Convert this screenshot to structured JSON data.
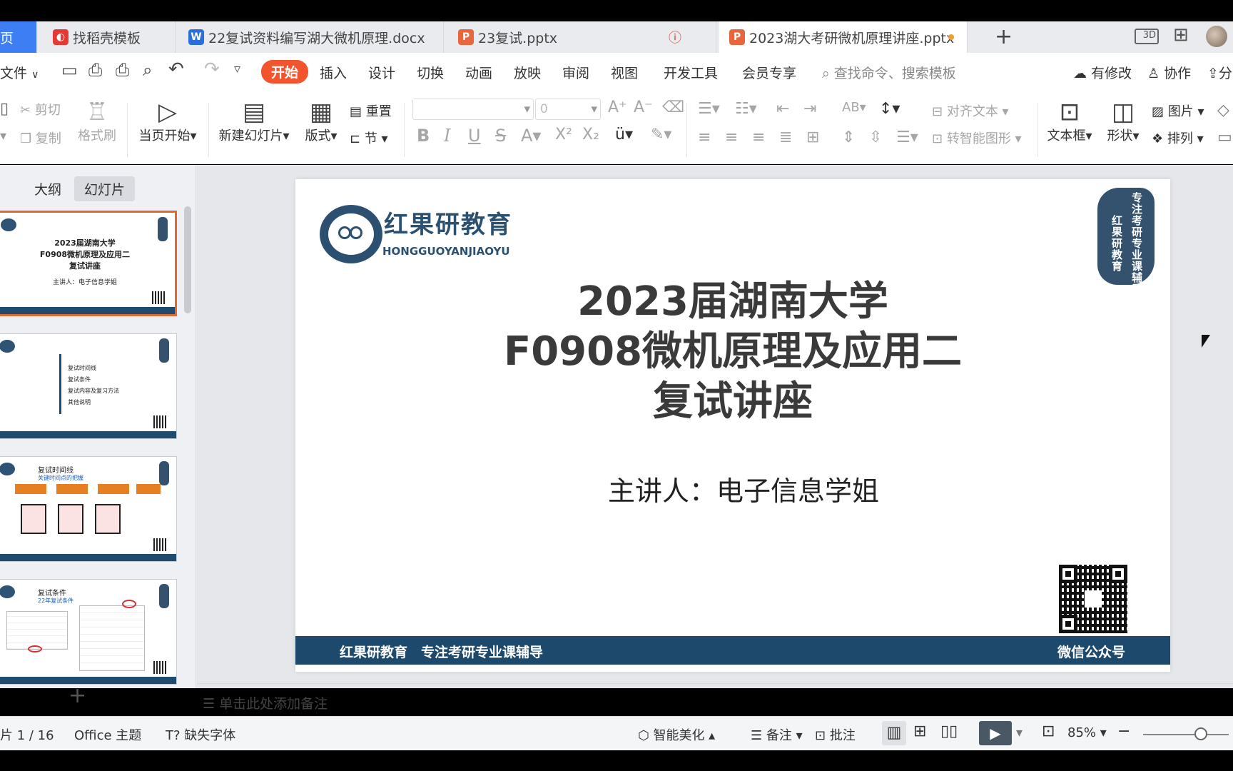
{
  "tabs": [
    {
      "label": "页",
      "color": "#3d7ef5"
    },
    {
      "label": "找稻壳模板",
      "color": "#e53935"
    },
    {
      "label": "22复试资料编写湖大微机原理.docx",
      "color": "#2b6fd8"
    },
    {
      "label": "23复试.pptx",
      "color": "#e7663e"
    },
    {
      "label": "2023湖大考研微机原理讲座.pptx",
      "color": "#e7663e"
    }
  ],
  "tab_new": "+",
  "window_icons": {
    "view": "3D",
    "grid": "⊞"
  },
  "menu": {
    "file": "文件",
    "items": [
      "开始",
      "插入",
      "设计",
      "切换",
      "动画",
      "放映",
      "审阅",
      "视图",
      "开发工具",
      "会员专享"
    ],
    "search": "查找命令、搜索模板",
    "modified": "有修改",
    "collab": "协作",
    "share": "分"
  },
  "ribbon": {
    "cut": "剪切",
    "copy": "复制",
    "format_painter": "格式刷",
    "from_current": "当页开始",
    "new_slide": "新建幻灯片",
    "layout": "版式",
    "reset": "重置",
    "section": "节",
    "font_size": "0",
    "align_text": "对齐文本",
    "smartart": "转智能图形",
    "textbox": "文本框",
    "shape": "形状",
    "picture": "图片",
    "arrange": "排列"
  },
  "panel": {
    "outline": "大纲",
    "slides": "幻灯片",
    "add": "+"
  },
  "thumbs": [
    {
      "line1": "2023届湖南大学",
      "line2": "F0908微机原理及应用二",
      "line3": "复试讲座",
      "line4": "主讲人：电子信息学姐"
    },
    {
      "line1": "复试时间线",
      "line2": "复试条件",
      "line3": "复试内容及复习方法",
      "line4": "其他说明"
    },
    {
      "line1": "复试时间线",
      "line2": "关键时间点的把握",
      "line3": "",
      "line4": ""
    },
    {
      "line1": "复试条件",
      "line2": "22年复试条件",
      "line3": "",
      "line4": ""
    }
  ],
  "slide": {
    "logo_cn": "红果研教育",
    "logo_en": "HONGGUOYANJIAOYU",
    "stamp_col1": "专注考研专业课辅导",
    "stamp_col2": "红果研教育",
    "title1": "2023届湖南大学",
    "title2": "F0908微机原理及应用二",
    "title3": "复试讲座",
    "presenter": "主讲人：电子信息学姐",
    "footer_left": "红果研教育　专注考研专业课辅导",
    "footer_right": "微信公众号"
  },
  "notes_placeholder": "单击此处添加备注",
  "status": {
    "slide_count": "片 1 / 16",
    "theme": "Office 主题",
    "missing_font": "缺失字体",
    "beautify": "智能美化",
    "notes": "备注",
    "comment": "批注",
    "zoom": "85%"
  },
  "colors": {
    "accent": "#f2542d",
    "footer": "#1d4a6c",
    "thumb_select": "#e06a2e"
  }
}
